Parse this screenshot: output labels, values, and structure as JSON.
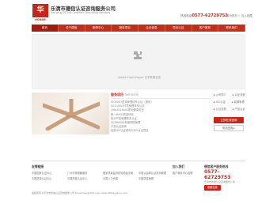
{
  "header": {
    "logo_char": "华",
    "logo_en": "HONOR",
    "company_name": "乐清市德信认证咨询服务公司",
    "company_en": "Yue qing DE XIN Certified Consulting Services",
    "hotline_label": "热线电话",
    "hotline_number": "0577-62729753",
    "top_links": [
      "设为首页",
      "加入收藏"
    ]
  },
  "nav": [
    "首页",
    "关于德信",
    "新闻中心",
    "服务项目",
    "企业信息",
    "项目认证",
    "客户服务",
    "联系我们"
  ],
  "flash": {
    "message": "Adobe Flash Player 已不再受支持"
  },
  "services": {
    "title": "服务项目",
    "title_en": "Services",
    "items": [
      "ISO9001质量管理体系认证（德信）",
      "ISO14001环境管理体系认证",
      "OHSAS18001职业健康安全",
      "新一代ISO质量体系",
      "知识产权管理体系认证",
      "QC080000有害物质管理",
      "产品认证咨询",
      "免费ISO认证咨询与ISO认证项目"
    ]
  },
  "side": {
    "rows": [
      [
        "公司简介",
        "认证流程"
      ],
      [
        "ISO认证",
        "能源管理"
      ],
      [
        "认证流程",
        "产品认证"
      ]
    ],
    "consult_label": "立即在线咨询",
    "ad_label": "电话咨询 ▸"
  },
  "friend_links": {
    "title": "友情链接",
    "items": [
      "中国国家认证中心",
      "广州好得维翰服务",
      "国家质量监督检验检疫总局",
      "中国认监委认证机构管理",
      "中国质量认证中心",
      "中国质量认证中心",
      "中国人力资源",
      "中国质量管理"
    ]
  },
  "join": {
    "title": "加入我们",
    "sub": "客户服务中心招聘"
  },
  "contact": {
    "title": "德信客户服务热线",
    "number": "0577-62729753",
    "sub": "乐清市德信认证咨询服务公司",
    "qq_label": "客服在线"
  },
  "footer": {
    "line": "版权所有©乐清市德信认证咨询服务公司   Email:kiso@163.com  kiwen360@yahoo.com"
  }
}
